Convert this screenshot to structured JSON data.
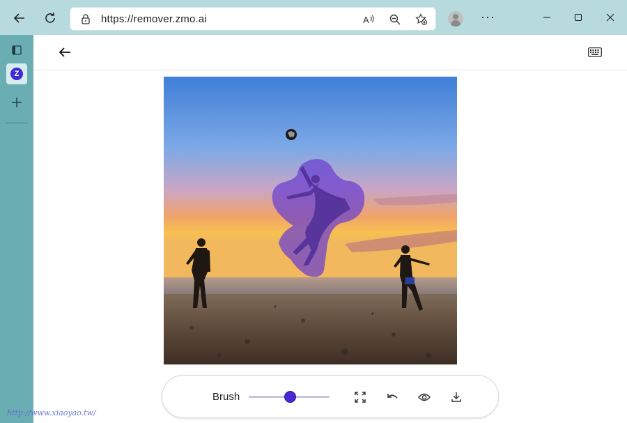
{
  "browser": {
    "url": "https://remover.zmo.ai",
    "menu_glyph": "···",
    "nav": {
      "back": "back",
      "reload": "reload"
    }
  },
  "sidebar": {
    "active_tab_letter": "Z"
  },
  "toolbar": {
    "brush_label": "Brush",
    "brush_size_fraction": 0.44
  },
  "colors": {
    "accent": "#4b28d6",
    "mask": "#6a3fd0",
    "browser_chrome": "#b6dade",
    "sidebar": "#6aaeb4"
  },
  "icons": [
    "back-arrow-icon",
    "reload-icon",
    "lock-icon",
    "read-aloud-icon",
    "zoom-out-icon",
    "favorite-add-icon",
    "profile-avatar",
    "more-icon",
    "minimize-icon",
    "maximize-icon",
    "close-icon",
    "sidebar-toggle-icon",
    "zmo-logo-icon",
    "add-tab-icon",
    "keyboard-icon",
    "fullscreen-icon",
    "undo-icon",
    "eye-icon",
    "download-icon"
  ],
  "watermark": "http://www.xiaoyao.tw/"
}
